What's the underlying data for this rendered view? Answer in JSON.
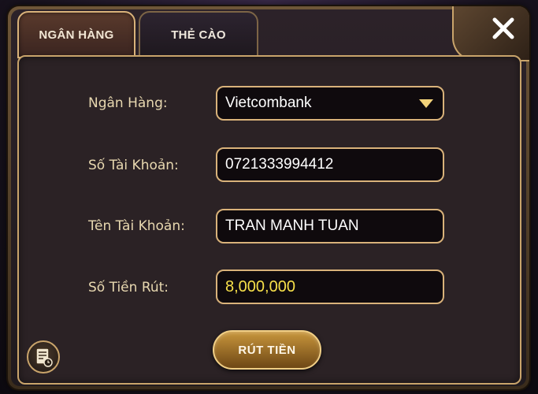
{
  "tabs": {
    "bank_label": "NGÂN HÀNG",
    "card_label": "THẺ CÀO"
  },
  "form": {
    "bank_label": "Ngân Hàng:",
    "bank_value": "Vietcombank",
    "account_number_label": "Số Tài Khoản:",
    "account_number_value": "0721333994412",
    "account_name_label": "Tên Tài Khoản:",
    "account_name_value": "TRAN MANH TUAN",
    "amount_label": "Số Tiền Rút:",
    "amount_value": "8,000,000"
  },
  "actions": {
    "submit_label": "RÚT TIỀN"
  },
  "icons": {
    "close": "close-icon",
    "dropdown": "chevron-down-icon",
    "history": "history-document-icon"
  },
  "colors": {
    "gold_border": "#d9b27a",
    "amount_text": "#f7e04a",
    "label_text": "#e8d8b0"
  }
}
